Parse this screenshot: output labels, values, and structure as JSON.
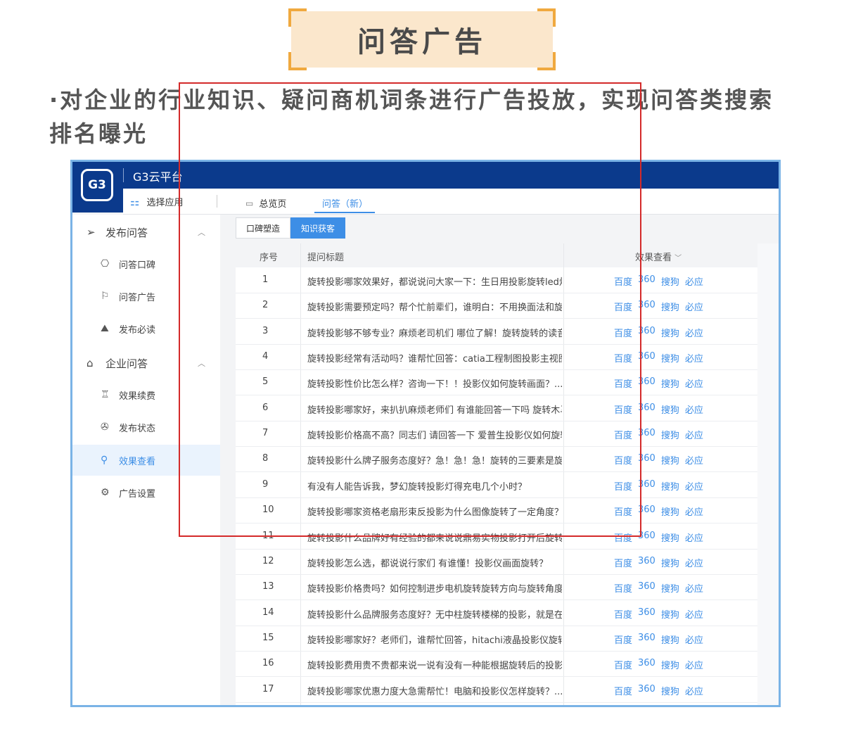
{
  "header": {
    "title": "问答广告",
    "subtitle": "·对企业的行业知识、疑问商机词条进行广告投放，实现问答类搜索排名曝光"
  },
  "app": {
    "logo": "G3",
    "brand": "G3云平台",
    "select_app": "选择应用",
    "tabs": [
      {
        "label": "总览页",
        "icon": "monitor-icon"
      },
      {
        "label": "问答（新）",
        "active": true
      }
    ]
  },
  "sidebar": {
    "groups": [
      {
        "label": "发布问答",
        "icon": "send-icon",
        "items": [
          {
            "label": "问答口碑",
            "icon": "badge-icon"
          },
          {
            "label": "问答广告",
            "icon": "flag-icon"
          },
          {
            "label": "发布必读",
            "icon": "mountain-icon"
          }
        ]
      },
      {
        "label": "企业问答",
        "icon": "home-icon",
        "items": [
          {
            "label": "效果续费",
            "icon": "trophy-icon"
          },
          {
            "label": "发布状态",
            "icon": "aperture-icon"
          },
          {
            "label": "效果查看",
            "icon": "search-icon",
            "active": true
          },
          {
            "label": "广告设置",
            "icon": "gear-icon"
          }
        ]
      }
    ]
  },
  "subtabs": [
    "口碑塑造",
    "知识获客"
  ],
  "table": {
    "headers": {
      "index": "序号",
      "question": "提问标题",
      "effect": "效果查看"
    },
    "link_labels": [
      "百度",
      "360",
      "搜狗",
      "必应"
    ],
    "rows": [
      {
        "index": "1",
        "question": "旋转投影哪家效果好，都说说问大家一下：生日用投影旋转led灯"
      },
      {
        "index": "2",
        "question": "旋转投影需要预定吗？帮个忙前辈们，谁明白：不用换面法和旋"
      },
      {
        "index": "3",
        "question": "旋转投影够不够专业？麻烦老司机们 哪位了解！旋转旋转的读音"
      },
      {
        "index": "4",
        "question": "旋转投影经常有活动吗？谁帮忙回答：catia工程制图投影主视图"
      },
      {
        "index": "5",
        "question": "旋转投影性价比怎么样？咨询一下！！投影仪如何旋转画面？..."
      },
      {
        "index": "6",
        "question": "旋转投影哪家好，来扒扒麻烦老师们 有谁能回答一下吗 旋转木马"
      },
      {
        "index": "7",
        "question": "旋转投影价格高不高？同志们 请回答一下 爱普生投影仪如何旋转"
      },
      {
        "index": "8",
        "question": "旋转投影什么牌子服务态度好？急！急！急！旋转的三要素是旋"
      },
      {
        "index": "9",
        "question": "有没有人能告诉我，梦幻旋转投影灯得充电几个小时？"
      },
      {
        "index": "10",
        "question": "旋转投影哪家资格老扇形束反投影为什么图像旋转了一定角度？"
      },
      {
        "index": "11",
        "question": "旋转投影什么品牌好有经验的都来说说鼎易实物投影打开后旋转"
      },
      {
        "index": "12",
        "question": "旋转投影怎么选，都说说行家们 有谁懂！投影仪画面旋转？"
      },
      {
        "index": "13",
        "question": "旋转投影价格贵吗？如何控制进步电机旋转旋转方向与旋转角度"
      },
      {
        "index": "14",
        "question": "旋转投影什么品牌服务态度好？无中柱旋转楼梯的投影，就是在"
      },
      {
        "index": "15",
        "question": "旋转投影哪家好？老师们，谁帮忙回答，hitachi液晶投影仪旋转"
      },
      {
        "index": "16",
        "question": "旋转投影费用贵不贵都来说一说有没有一种能根据旋转后的投影"
      },
      {
        "index": "17",
        "question": "旋转投影哪家优惠力度大急需帮忙！电脑和投影仪怎样旋转？..."
      }
    ]
  }
}
